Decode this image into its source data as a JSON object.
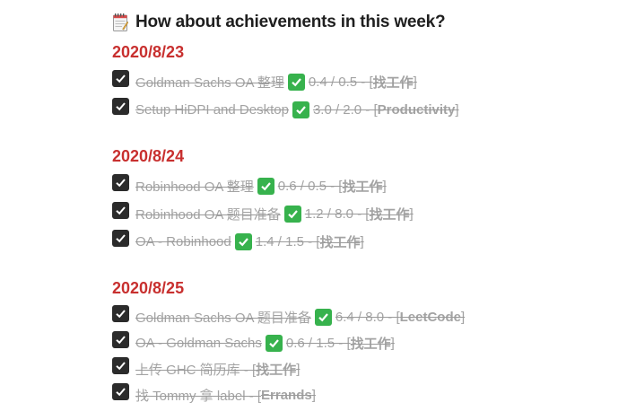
{
  "header": {
    "icon": "memo-icon",
    "title": "How about achievements in this week?"
  },
  "days": [
    {
      "date": "2020/8/23",
      "tasks": [
        {
          "name": "Goldman Sachs OA 整理",
          "done_icon": "white-check-mark-icon",
          "progress": "0.4 / 0.5 - [",
          "tag": "找工作",
          "close": "]"
        },
        {
          "name": "Setup HiDPI and Desktop",
          "done_icon": "white-check-mark-icon",
          "progress": "3.0 / 2.0 - [",
          "tag": "Productivity",
          "close": "]"
        }
      ]
    },
    {
      "date": "2020/8/24",
      "tasks": [
        {
          "name": "Robinhood OA 整理",
          "done_icon": "white-check-mark-icon",
          "progress": "0.6 / 0.5 - [",
          "tag": "找工作",
          "close": "]"
        },
        {
          "name": "Robinhood OA 题目准备",
          "done_icon": "white-check-mark-icon",
          "progress": "1.2 / 8.0 - [",
          "tag": "找工作",
          "close": "]"
        },
        {
          "name": "OA - Robinhood",
          "done_icon": "white-check-mark-icon",
          "progress": "1.4 / 1.5 - [",
          "tag": "找工作",
          "close": "]"
        }
      ]
    },
    {
      "date": "2020/8/25",
      "tasks": [
        {
          "name": "Goldman Sachs OA 题目准备",
          "done_icon": "white-check-mark-icon",
          "progress": "6.4 / 8.0 - [",
          "tag": "LeetCode",
          "close": "]"
        },
        {
          "name": "OA - Goldman Sachs",
          "done_icon": "white-check-mark-icon",
          "progress": "0.6 / 1.5 - [",
          "tag": "找工作",
          "close": "]"
        },
        {
          "name": "上传 GHC 简历库 - [",
          "tag": "找工作",
          "close": "]"
        },
        {
          "name": "找 Tommy 拿 label - [",
          "tag": "Errands",
          "close": "]"
        }
      ]
    }
  ],
  "colors": {
    "date": "#c8302f",
    "checkbox": "#2b2b2b",
    "done_emoji": "#37b24d",
    "struck_text": "#a3a3a3"
  }
}
